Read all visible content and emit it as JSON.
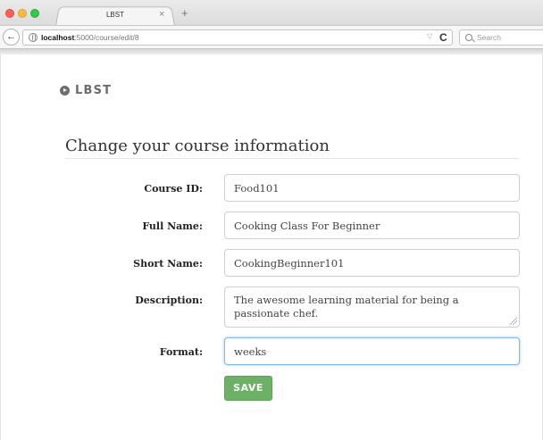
{
  "browser": {
    "tab_title": "LBST",
    "tab_close": "×",
    "new_tab": "+",
    "back": "←",
    "url_host": "localhost",
    "url_path": ":5000/course/edit/8",
    "url_dropdown": "▽",
    "reload": "C",
    "search_placeholder": "Search"
  },
  "page": {
    "logo_text": "LBST",
    "heading": "Change your course information",
    "form": {
      "fields": [
        {
          "label": "Course ID:",
          "value": "Food101"
        },
        {
          "label": "Full Name:",
          "value": "Cooking Class For Beginner"
        },
        {
          "label": "Short Name:",
          "value": "CookingBeginner101"
        },
        {
          "label": "Description:",
          "value": "The awesome learning material for being a passionate chef."
        },
        {
          "label": "Format:",
          "value": "weeks"
        }
      ],
      "save_label": "SAVE"
    }
  }
}
